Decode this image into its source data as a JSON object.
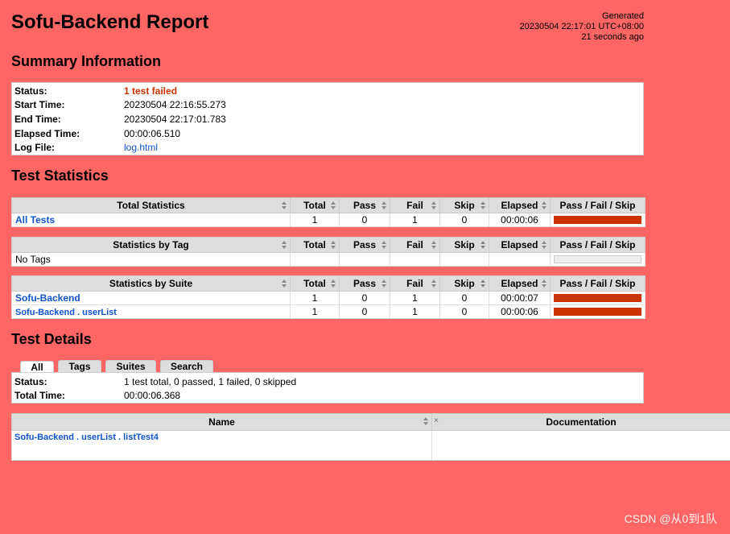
{
  "title": "Sofu-Backend Report",
  "generated": {
    "label": "Generated",
    "datetime": "20230504 22:17:01 UTC+08:00",
    "ago": "21 seconds ago"
  },
  "summary": {
    "heading": "Summary Information",
    "rows": [
      {
        "label": "Status:",
        "value": "1 test failed"
      },
      {
        "label": "Start Time:",
        "value": "20230504 22:16:55.273"
      },
      {
        "label": "End Time:",
        "value": "20230504 22:17:01.783"
      },
      {
        "label": "Elapsed Time:",
        "value": "00:00:06.510"
      },
      {
        "label": "Log File:",
        "value": "log.html"
      }
    ]
  },
  "statistics": {
    "heading": "Test Statistics",
    "columns": [
      "Total",
      "Pass",
      "Fail",
      "Skip",
      "Elapsed",
      "Pass / Fail / Skip"
    ],
    "total": {
      "header": "Total Statistics",
      "rows": [
        {
          "name": "All Tests",
          "total": "1",
          "pass": "0",
          "fail": "1",
          "skip": "0",
          "elapsed": "00:00:06",
          "fail_ratio": 1
        }
      ]
    },
    "tag": {
      "header": "Statistics by Tag",
      "rows": [
        {
          "name": "No Tags"
        }
      ]
    },
    "suite": {
      "header": "Statistics by Suite",
      "rows": [
        {
          "name": "Sofu-Backend",
          "total": "1",
          "pass": "0",
          "fail": "1",
          "skip": "0",
          "elapsed": "00:00:07",
          "fail_ratio": 1
        },
        {
          "name": "Sofu-Backend . userList",
          "total": "1",
          "pass": "0",
          "fail": "1",
          "skip": "0",
          "elapsed": "00:00:06",
          "fail_ratio": 1
        }
      ]
    }
  },
  "details": {
    "heading": "Test Details",
    "tabs": [
      "All",
      "Tags",
      "Suites",
      "Search"
    ],
    "status_label": "Status:",
    "status_value": "1 test total, 0 passed, 1 failed, 0 skipped",
    "time_label": "Total Time:",
    "time_value": "00:00:06.368",
    "columns": [
      "Name",
      "Documentation"
    ],
    "close_glyph": "×",
    "test_name": "Sofu-Backend . userList . listTest4"
  },
  "watermark": "CSDN @从0到1队",
  "colors": {
    "background": "#fe6666",
    "fail": "#cc3300",
    "link": "#1155cc"
  }
}
